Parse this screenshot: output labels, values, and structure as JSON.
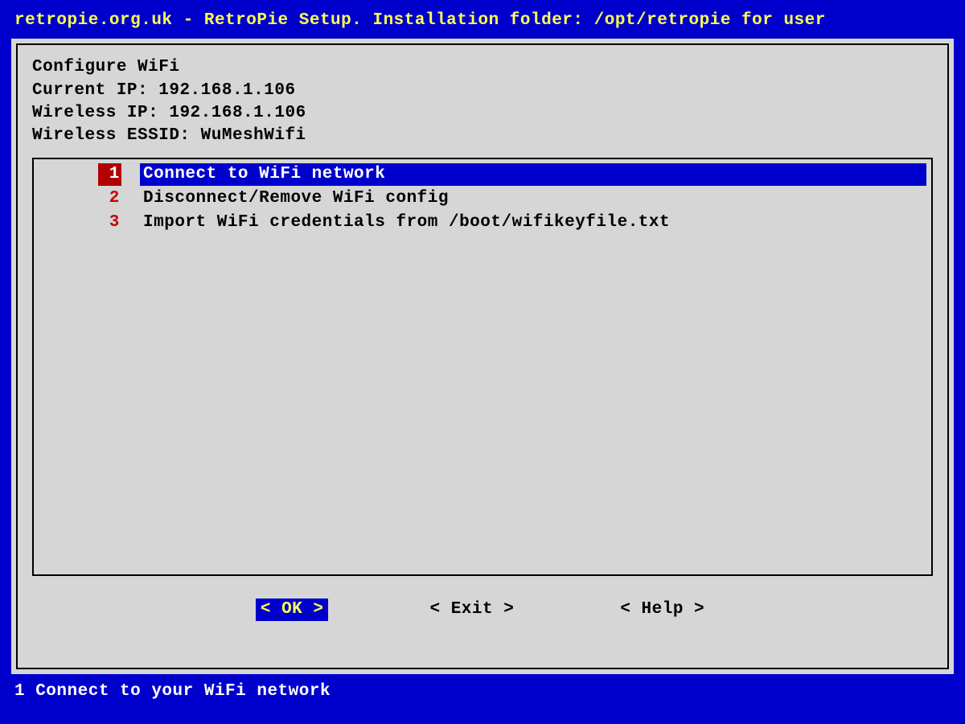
{
  "titlebar": "retropie.org.uk - RetroPie Setup. Installation folder: /opt/retropie for user",
  "dialog": {
    "heading": "Configure WiFi",
    "current_ip_label": "Current IP:",
    "current_ip_value": "192.168.1.106",
    "wireless_ip_label": "Wireless IP:",
    "wireless_ip_value": "192.168.1.106",
    "wireless_essid_label": "Wireless ESSID:",
    "wireless_essid_value": "WuMeshWifi"
  },
  "menu": {
    "items": [
      {
        "num": "1",
        "label": "Connect to WiFi network",
        "selected": true
      },
      {
        "num": "2",
        "label": "Disconnect/Remove WiFi config",
        "selected": false
      },
      {
        "num": "3",
        "label": "Import WiFi credentials from /boot/wifikeyfile.txt",
        "selected": false
      }
    ]
  },
  "buttons": {
    "ok": "<  OK  >",
    "exit": "< Exit >",
    "help": "< Help >"
  },
  "statusbar": "1 Connect to your WiFi network"
}
